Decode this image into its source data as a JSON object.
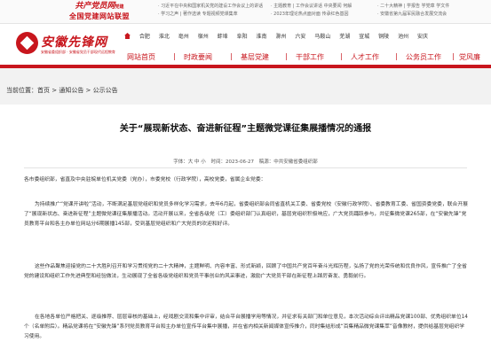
{
  "topbar": {
    "union_name": "共产党员网",
    "union_tag": "党建",
    "union_subtitle": "全国党建网站联盟",
    "links_row1": [
      "· 习近平在中央和国家机关党的建设工作会议上的讲话",
      "· 主题教育 | 工作会议讲话 中央要闻 何解",
      "· 二十大精神 | 学报告 学党章 学文件"
    ],
    "links_row2": [
      "· 学习之声 | 著作选读 专题视频党课集萃",
      "· 2023年理论热点面对面 传承红色基因",
      "· 安徽省第九届军民融合发展交流会"
    ]
  },
  "header": {
    "logo_name": "安徽先锋网",
    "logo_slogan": "安徽省委组织部 · 安徽省党员干部现代远程教育",
    "cities": [
      "合肥",
      "淮北",
      "亳州",
      "宿州",
      "蚌埠",
      "阜阳",
      "淮南",
      "滁州",
      "六安",
      "马鞍山",
      "芜湖",
      "宣城",
      "铜陵",
      "池州",
      "安庆"
    ],
    "nav": [
      "网站首页",
      "时政要闻",
      "基层党建",
      "干部工作",
      "人才工作",
      "公务员工作",
      "党风廉"
    ]
  },
  "breadcrumb": {
    "prefix": "当前位置：",
    "home": "首页",
    "sep1": " > ",
    "section": "通知公告",
    "sep2": " > ",
    "current": "公示公告"
  },
  "article": {
    "title": "关于“展现新状态、奋进新征程”主题微党课征集展播情况的通报",
    "meta_font": "字体：大 中 小",
    "meta_time": "时间：2023-06-27",
    "meta_source": "稿源：中共安徽省委组织部",
    "paragraphs": [
      "各市委组织部，省直及中央驻皖单位机关党委（党办），市委党校（行政学院），高校党委，省属企业党委：",
      "为持续推广“党课开讲啦”活动，不断满足基层党组织和党员多样化学习需求，去年6月起，省委组织部会同省直机关工委、省委党校（安徽行政学院）、省委教育工委、省国资委党委，联合开展了“展现新状态、奋进新征程”主题微党课征集展播活动。活动开展以来，全省各级党（工）委组织部门认真组织，基层党组织积极响应，广大党员踊跃参与，共征集微党课265部，在“安徽先锋”党员教育平台和各主办单位网站分6期展播145部，受到基层党组织和广大党员的欢迎和好评。",
      "这些作品聚焦迎接党的二十大胜利召开和学习贯彻党的二十大精神，主题鲜明、内容丰富、形式新颖，回顾了中国共产党百年奋斗光辉历程，弘扬了党的光荣传统和优良作风，宣传推广了全省党的建设和组织工作先进典型和经验做法，生动展现了全省各级党组织和党员干事创业的风采事迹，激励广大党员干部在新征程上踔厉奋发、勇毅前行。",
      "在各地各单位严格把关、逐级推荐、层层审核的基础上，经戏剧交流和集中评审，结合平台展播学用等情况，并征求有关部门和单位意见，本次活动综合评出精品党课100部、优秀组织单位14个（名单附后）。精品党课将在“安徽先锋”系列党员教育平台和主办单位宣传平台集中展播，并在省内相关新闻媒体宣传推介，同时集结形成“百集精品微党课集萃”音像教材，提供给基层党组织学习使用。"
    ]
  },
  "colors": {
    "brand_red": "#c8161d",
    "page_bg": "#f2f2f2"
  }
}
